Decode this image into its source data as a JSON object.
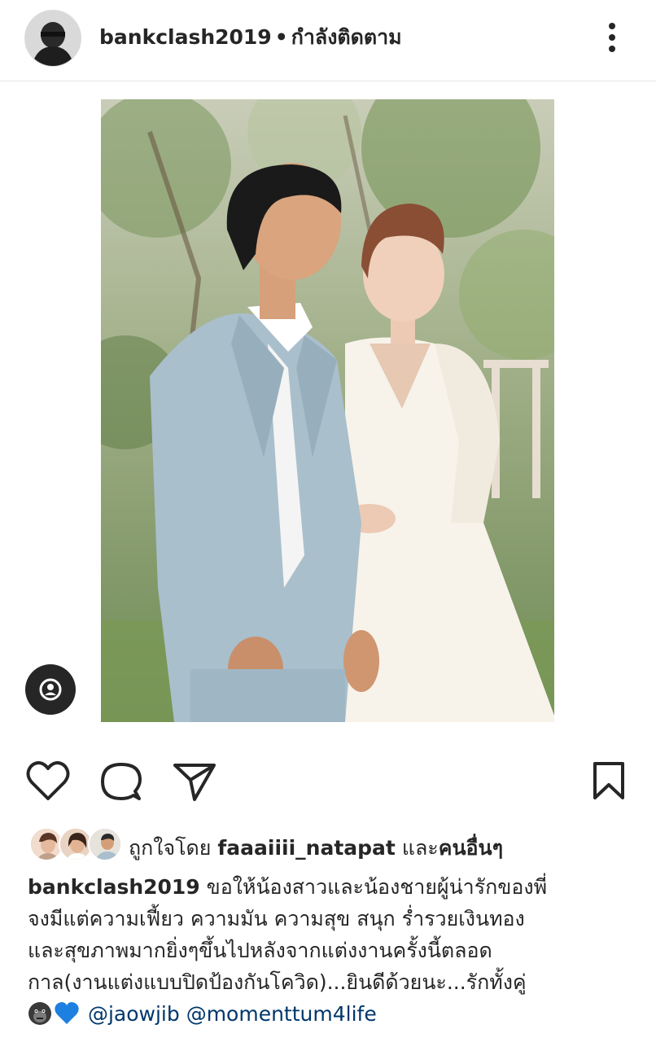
{
  "header": {
    "username": "bankclash2019",
    "separator": "•",
    "follow_status": "กำลังติดตาม",
    "more_icon": "more-vertical-icon"
  },
  "post": {
    "photo_alt": "wedding photo",
    "user_tag_icon": "user-tag-icon"
  },
  "actions": {
    "like_icon": "heart-icon",
    "comment_icon": "comment-icon",
    "share_icon": "send-icon",
    "save_icon": "bookmark-icon"
  },
  "likes": {
    "prefix": "ถูกใจโดย",
    "user": "faaaiiii_natapat",
    "connector": "และ",
    "others": "คนอื่นๆ"
  },
  "caption": {
    "username": "bankclash2019",
    "line1": "ขอให้น้องสาวและน้องชายผู้น่ารักของพี่",
    "line2": "จงมีแต่ความเฟี้ยว ความมัน ความสุข สนุก ร่ำรวยเงินทอง",
    "line3": "และสุขภาพมากยิ่งๆขึ้นไปหลังจากแต่งงานครั้งนี้ตลอด",
    "line4": "กาล(งานแต่งแบบปิดป้องกันโควิด)...ยินดีด้วยนะ...รักทั้งคู่",
    "mentions": [
      "@jaowjib",
      "@momenttum4life"
    ],
    "emojis": [
      "gorilla-emoji",
      "blue-heart-emoji"
    ]
  },
  "colors": {
    "text": "#262626",
    "mention": "#00376b",
    "divider": "#e6e6e6",
    "suit": "#a9bfcc",
    "dress": "#f7f3ea"
  }
}
